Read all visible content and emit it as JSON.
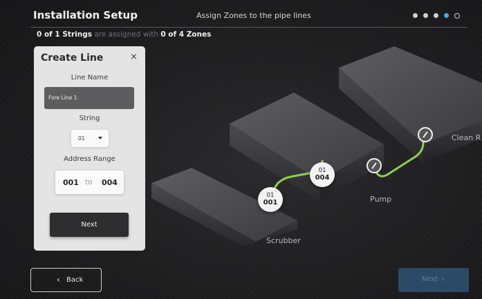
{
  "header": {
    "title": "Installation Setup",
    "subtitle": "Assign Zones to the pipe lines",
    "progress": {
      "steps": 5,
      "current": 4
    }
  },
  "status": {
    "strings_assigned": "0 of 1 Strings",
    "middle": "are assigned with",
    "zones": "0 of 4 Zones"
  },
  "panel": {
    "title": "Create Line",
    "close_label": "×",
    "line_name_label": "Line Name",
    "line_name_value": "Fore Line 1",
    "string_label": "String",
    "string_value": "01",
    "address_label": "Address Range",
    "address_from": "001",
    "address_to_word": "to",
    "address_to": "004",
    "next_label": "Next"
  },
  "scene": {
    "labels": {
      "scrubber": "Scrubber",
      "pump": "Pump",
      "clean": "Clean R"
    },
    "node_start": {
      "top": "01",
      "bottom": "001"
    },
    "node_end": {
      "top": "01",
      "bottom": "004"
    }
  },
  "footer": {
    "back_icon": "‹",
    "back_label": "Back",
    "next_label": "Next",
    "next_icon": "›"
  },
  "colors": {
    "accent": "#4aa8e6",
    "pipe": "#8fd14a",
    "next_disabled_bg": "#2c4a66"
  }
}
